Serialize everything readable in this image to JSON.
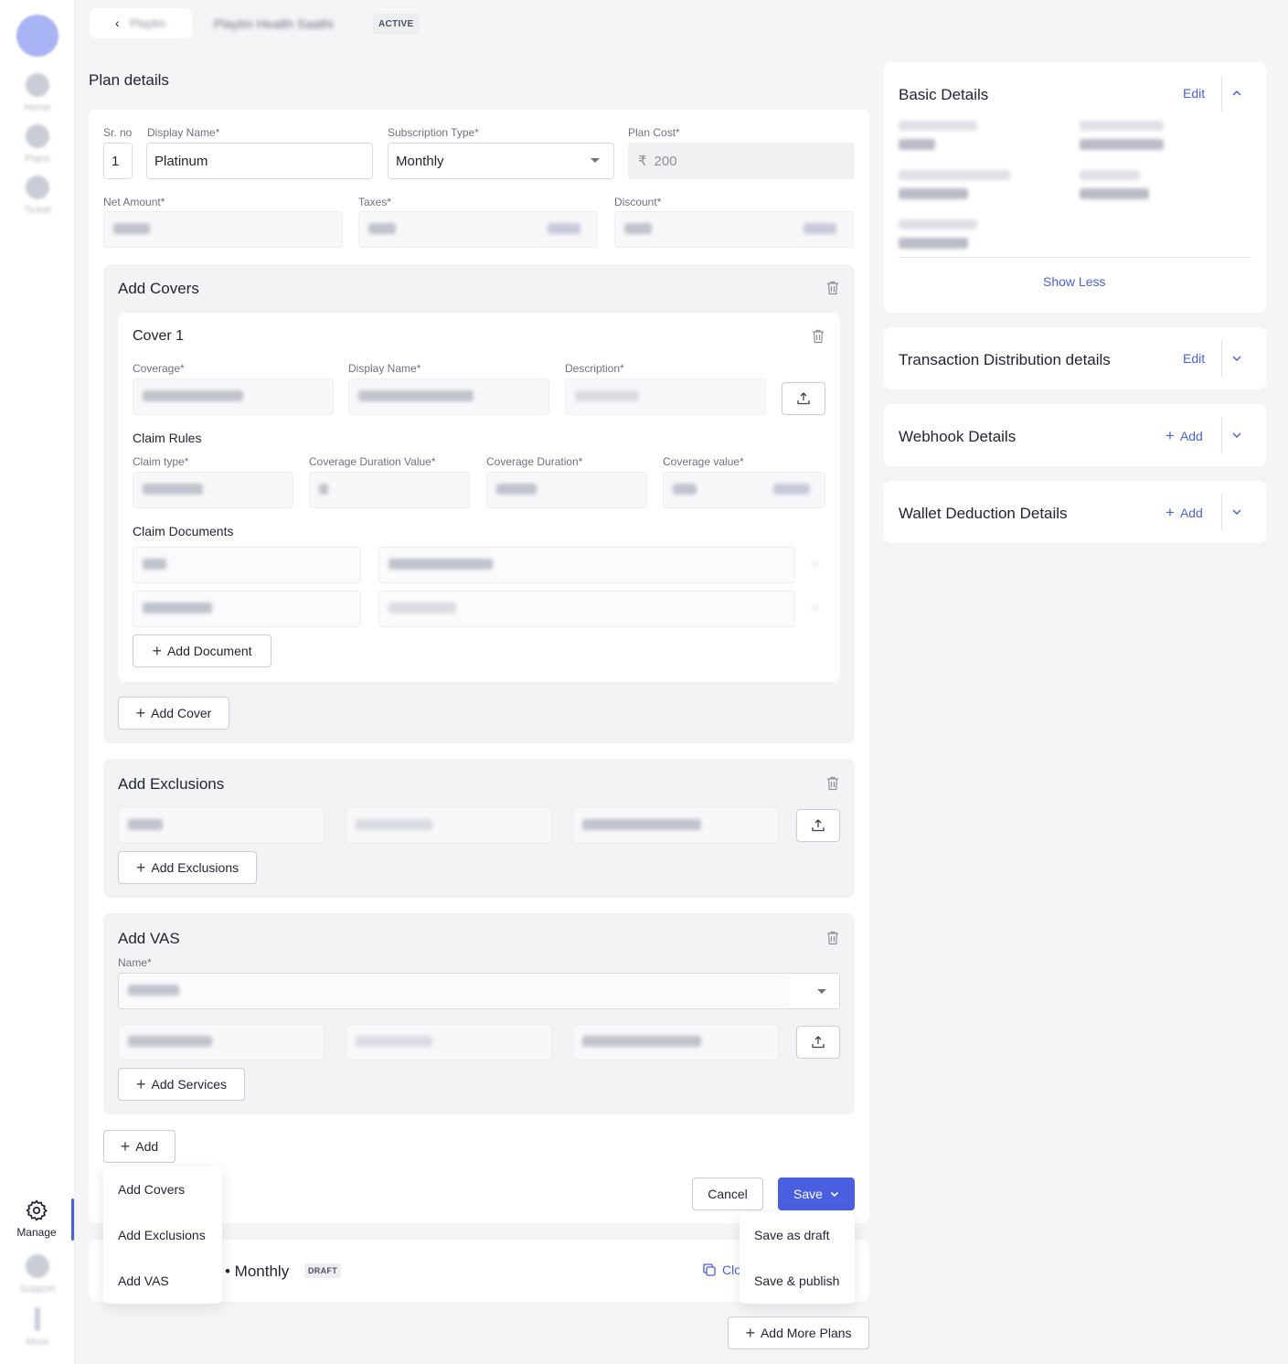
{
  "sidebar": {
    "items": [
      {
        "label": "Home",
        "icon": "home-icon"
      },
      {
        "label": "Plans",
        "icon": "document-icon"
      },
      {
        "label": "Ticket",
        "icon": "ticket-icon"
      }
    ],
    "bottom": [
      {
        "label": "Manage",
        "icon": "gear-icon"
      },
      {
        "label": "Support",
        "icon": "headset-icon"
      },
      {
        "label": "More",
        "icon": "more-icon"
      }
    ]
  },
  "header": {
    "back_label": "Playtm",
    "title": "Playtm Health Saathi",
    "status_badge": "ACTIVE"
  },
  "plan_details": {
    "heading": "Plan details",
    "sr_no_label": "Sr. no",
    "sr_no_value": "1",
    "display_name_label": "Display Name*",
    "display_name_value": "Platinum",
    "subscription_type_label": "Subscription Type*",
    "subscription_type_value": "Monthly",
    "plan_cost_label": "Plan Cost*",
    "plan_cost_currency": "₹",
    "plan_cost_value": "200",
    "net_amount_label": "Net Amount*",
    "taxes_label": "Taxes*",
    "discount_label": "Discount*"
  },
  "covers": {
    "heading": "Add Covers",
    "cover_title": "Cover 1",
    "coverage_label": "Coverage*",
    "display_name_label": "Display Name*",
    "description_label": "Description*",
    "claim_rules_heading": "Claim Rules",
    "claim_type_label": "Claim type*",
    "coverage_duration_value_label": "Coverage Duration Value*",
    "coverage_duration_label": "Coverage Duration*",
    "coverage_value_label": "Coverage value*",
    "claim_documents_heading": "Claim Documents",
    "add_document_label": "Add Document",
    "add_cover_label": "Add Cover"
  },
  "exclusions": {
    "heading": "Add Exclusions",
    "add_label": "Add Exclusions"
  },
  "vas": {
    "heading": "Add VAS",
    "name_label": "Name*",
    "add_services_label": "Add Services"
  },
  "add_button": {
    "label": "Add",
    "menu": [
      "Add Covers",
      "Add Exclusions",
      "Add VAS"
    ]
  },
  "actions": {
    "cancel_label": "Cancel",
    "save_label": "Save",
    "save_menu": [
      "Save as draft",
      "Save & publish"
    ]
  },
  "second_plan": {
    "name": "• Monthly",
    "status_badge": "DRAFT",
    "clone_label": "Clo"
  },
  "add_more_plans_label": "Add More Plans",
  "right_panel": {
    "basic_details": {
      "title": "Basic Details",
      "edit_label": "Edit",
      "show_less_label": "Show Less"
    },
    "transaction": {
      "title": "Transaction Distribution details",
      "edit_label": "Edit"
    },
    "webhook": {
      "title": "Webhook Details",
      "add_label": "Add"
    },
    "wallet": {
      "title": "Wallet Deduction Details",
      "add_label": "Add"
    }
  },
  "colors": {
    "accent": "#4a5fe0",
    "background": "#f4f5f7"
  }
}
